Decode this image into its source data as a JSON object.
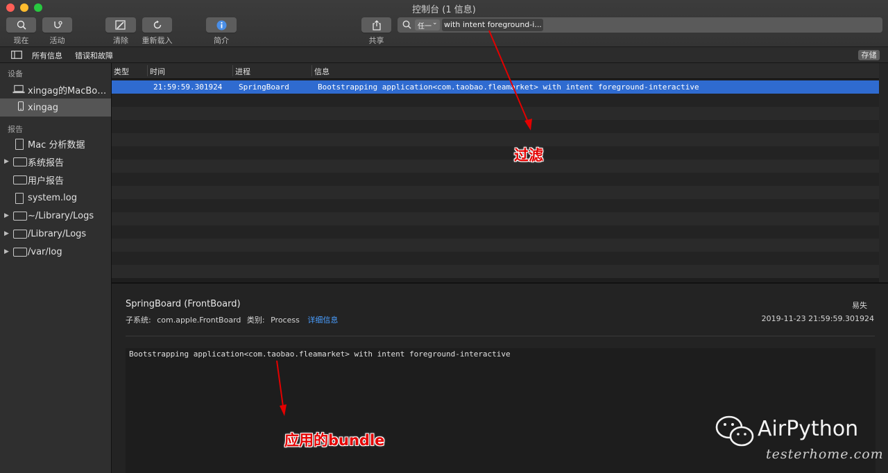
{
  "window": {
    "title": "控制台 (1 信息)"
  },
  "colors": {
    "accent": "#2f6bd0",
    "annotation": "#e30000",
    "link": "#4a9eff"
  },
  "toolbar": {
    "now_label": "现在",
    "activity_label": "活动",
    "clear_label": "清除",
    "reload_label": "重新载入",
    "info_label": "简介",
    "share_label": "共享",
    "search_scope": "任一",
    "search_token": "with intent foreground-i..."
  },
  "filters": {
    "all_messages": "所有信息",
    "errors_faults": "错误和故障",
    "save_label": "存储"
  },
  "sidebar": {
    "devices_section": "设备",
    "devices": [
      {
        "label": "xingag的MacBook Pro",
        "icon": "laptop-icon"
      },
      {
        "label": "xingag",
        "icon": "iphone-icon"
      }
    ],
    "reports_section": "报告",
    "reports": [
      {
        "label": "Mac 分析数据",
        "icon": "document-icon"
      },
      {
        "label": "系统报告",
        "icon": "folder-icon"
      },
      {
        "label": "用户报告",
        "icon": "folder-icon"
      },
      {
        "label": "system.log",
        "icon": "document-icon"
      },
      {
        "label": "~/Library/Logs",
        "icon": "folder-icon"
      },
      {
        "label": "/Library/Logs",
        "icon": "folder-icon"
      },
      {
        "label": "/var/log",
        "icon": "folder-icon"
      }
    ]
  },
  "table": {
    "columns": [
      "类型",
      "时间",
      "进程",
      "信息"
    ],
    "rows": [
      {
        "type": "",
        "time": "21:59:59.301924",
        "process": "SpringBoard",
        "message": "Bootstrapping application<com.taobao.fleamarket> with intent foreground-interactive"
      }
    ]
  },
  "detail": {
    "process": "SpringBoard (FrontBoard)",
    "subsystem_label": "子系统:",
    "subsystem": "com.apple.FrontBoard",
    "category_label": "类别:",
    "category": "Process",
    "more_info": "详细信息",
    "persistence": "易失",
    "timestamp": "2019-11-23 21:59:59.301924",
    "message": "Bootstrapping application<com.taobao.fleamarket> with intent foreground-interactive"
  },
  "annotations": {
    "filter_note": "过滤",
    "bundle_note": "应用的bundle"
  },
  "watermark": {
    "brand": "AirPython",
    "site": "testerhome.com"
  }
}
